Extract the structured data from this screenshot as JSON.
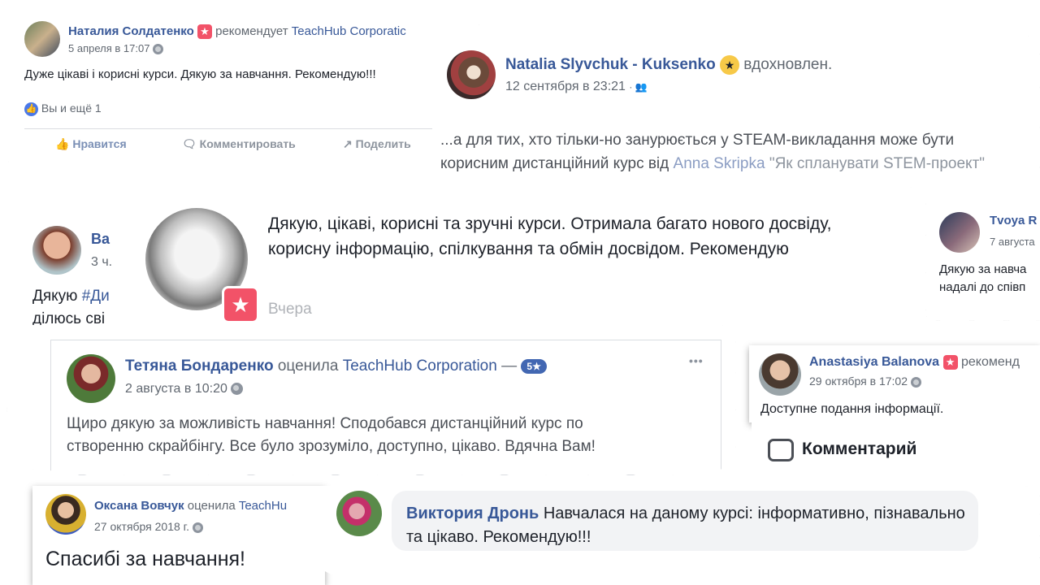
{
  "reviews": {
    "r1": {
      "author": "Наталия Солдатенко",
      "action": "рекомендует",
      "target": "TeachHub Corporatic",
      "date": "5 апреля в 17:07",
      "text": "Дуже цікаві і корисні курси. Дякую за навчання. Рекомендую!!!",
      "likes": "Вы и ещё 1",
      "like_btn": "Нравится",
      "comment_btn": "Комментировать",
      "share_btn": "Поделить"
    },
    "r2": {
      "author": "Natalia Slyvchuk - Kuksenko",
      "feeling": "вдохновлен.",
      "date": "12 сентября в 23:21",
      "text_before": "...а для тих, хто тільки-но занурюється у STEAM-викладання може бути корисним дистанційний курс від ",
      "mention": "Anna Skripka",
      "text_after": " \"Як спланувати STEM-проект\""
    },
    "r3": {
      "author_partial": "Ва",
      "date_partial": "3 ч.",
      "text_partial": "Дякую ",
      "hashtag": "#Ди",
      "text_partial2": "ділюсь сві"
    },
    "r4": {
      "text": "Дякую, цікаві, корисні та зручні курси. Отримала багато нового досвіду, корисну інформацію, спілкування та обмін досвідом. Рекомендую",
      "date": "Вчера"
    },
    "r5": {
      "author": "Tvoya R",
      "date": "7 августа",
      "text": "Дякую за навча надалі до співп"
    },
    "r6": {
      "author": "Тетяна Бондаренко",
      "action": "оценила",
      "target": "TeachHub Corporation",
      "dash": "—",
      "rating": "5★",
      "date": "2 августа в 10:20",
      "text": "Щиро дякую за можливість навчання! Сподобався дистанційний курс по створенню скрайбінгу. Все було зрозуміло, доступно, цікаво. Вдячна Вам!",
      "more": "•••"
    },
    "r7": {
      "author": "Anastasiya Balanova",
      "action": "рекоменд",
      "date": "29 октября в 17:02",
      "text": "Доступне подання інформації."
    },
    "r8": {
      "header": "Комментарий"
    },
    "r9": {
      "author": "Оксана Вовчук",
      "action": "оценила",
      "target": "TeachHu",
      "date": "27 октября 2018 г.",
      "text": "Спасибі за навчання!"
    },
    "r10": {
      "author": "Виктория Дронь",
      "text": "Навчалася на даному курсі: інформативно, пізнавально та цікаво. Рекомендую!!!"
    }
  },
  "colors": {
    "name_blue": "#385898",
    "badge_red": "#f25268",
    "rating_blue": "#4267b2",
    "gray_text": "#606770"
  }
}
